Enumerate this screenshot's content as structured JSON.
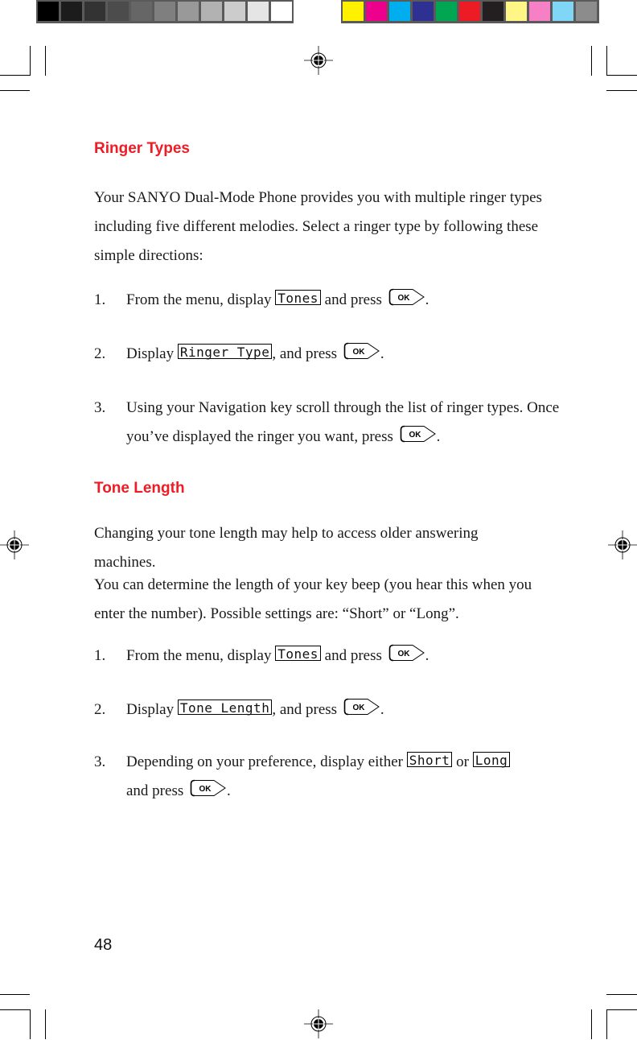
{
  "print_marks": {
    "gray_swatches": [
      "#000000",
      "#1c1c1c",
      "#333333",
      "#4c4c4c",
      "#666666",
      "#7f7f7f",
      "#999999",
      "#b2b2b2",
      "#cccccc",
      "#e5e5e5",
      "#ffffff"
    ],
    "color_swatches": [
      "#fff100",
      "#ec008c",
      "#00aeef",
      "#2e3192",
      "#00a651",
      "#ed1c24",
      "#231f20",
      "#fff685",
      "#f680c5",
      "#7fd6f7",
      "#8c8c8c"
    ]
  },
  "accent_color": "#ee1c24",
  "sections": [
    {
      "heading": "Ringer Types",
      "intro": "Your SANYO Dual-Mode Phone provides you with multiple ringer types including five different melodies. Select a ringer type by following these simple directions:",
      "steps": [
        {
          "num": "1.",
          "pre": "From the menu, display ",
          "lcd": "Tones",
          "mid": " and press ",
          "key": "OK",
          "post": "."
        },
        {
          "num": "2.",
          "pre": "Display ",
          "lcd": "Ringer Type",
          "mid": ", and press ",
          "key": "OK",
          "post": "."
        },
        {
          "num": "3.",
          "pre": "Using your Navigation key scroll through the list of ringer types. Once you’ve displayed the ringer you want, press ",
          "key": "OK",
          "post": "."
        }
      ]
    },
    {
      "heading": "Tone Length",
      "intro": "Changing your tone length may help to access older answering machines.",
      "intro2": "You can determine the length of your key beep (you hear this when you enter the number). Possible settings are: “Short” or “Long”.",
      "steps": [
        {
          "num": "1.",
          "pre": "From the menu, display ",
          "lcd": "Tones",
          "mid": " and press ",
          "key": "OK",
          "post": "."
        },
        {
          "num": "2.",
          "pre": "Display ",
          "lcd": "Tone Length",
          "mid": ", and press ",
          "key": "OK",
          "post": "."
        },
        {
          "num": "3.",
          "pre": "Depending on your preference, display either ",
          "lcd": "Short",
          "mid": " or ",
          "lcd2": "Long",
          "pre2": "and press ",
          "key": "OK",
          "post": "."
        }
      ]
    }
  ],
  "page_number": "48"
}
